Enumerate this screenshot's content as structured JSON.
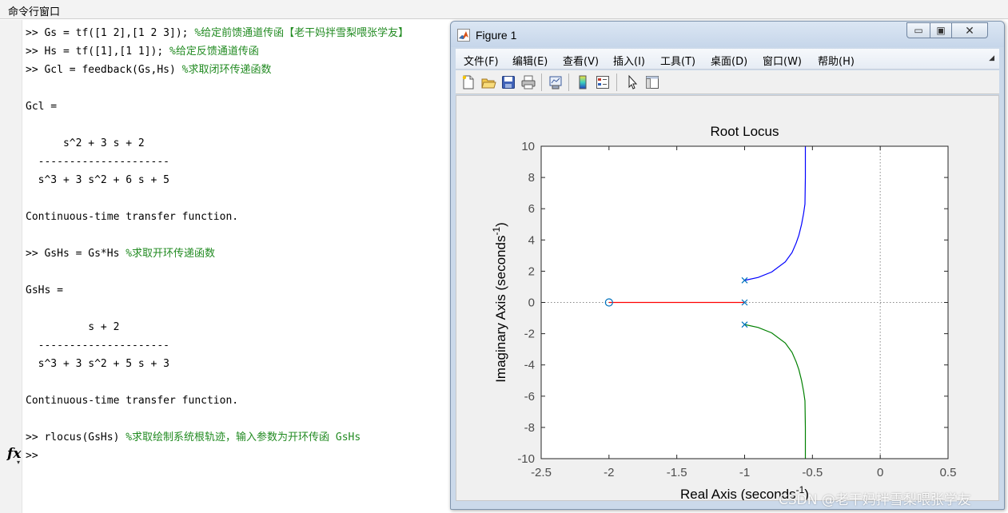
{
  "command_window": {
    "title": "命令行窗口",
    "lines": [
      {
        "code": ">> Gs = tf([1 2],[1 2 3]); ",
        "comment": "%给定前馈通道传函【老干妈拌雪梨喂张学友】"
      },
      {
        "code": ">> Hs = tf([1],[1 1]); ",
        "comment": "%给定反馈通道传函"
      },
      {
        "code": ">> Gcl = feedback(Gs,Hs) ",
        "comment": "%求取闭环传递函数"
      },
      {
        "code": "",
        "comment": ""
      },
      {
        "code": "Gcl =",
        "comment": ""
      },
      {
        "code": "",
        "comment": ""
      },
      {
        "code": "      s^2 + 3 s + 2",
        "comment": ""
      },
      {
        "code": "  ---------------------",
        "comment": ""
      },
      {
        "code": "  s^3 + 3 s^2 + 6 s + 5",
        "comment": ""
      },
      {
        "code": "",
        "comment": ""
      },
      {
        "code": "Continuous-time transfer function.",
        "comment": ""
      },
      {
        "code": "",
        "comment": ""
      },
      {
        "code": ">> GsHs = Gs*Hs ",
        "comment": "%求取开环传递函数"
      },
      {
        "code": "",
        "comment": ""
      },
      {
        "code": "GsHs =",
        "comment": ""
      },
      {
        "code": "",
        "comment": ""
      },
      {
        "code": "          s + 2",
        "comment": ""
      },
      {
        "code": "  ---------------------",
        "comment": ""
      },
      {
        "code": "  s^3 + 3 s^2 + 5 s + 3",
        "comment": ""
      },
      {
        "code": "",
        "comment": ""
      },
      {
        "code": "Continuous-time transfer function.",
        "comment": ""
      },
      {
        "code": "",
        "comment": ""
      },
      {
        "code": ">> rlocus(GsHs) ",
        "comment": "%求取绘制系统根轨迹，输入参数为开环传函 GsHs"
      },
      {
        "code": ">>",
        "comment": ""
      }
    ],
    "fx_icon": "fx-function-browser-icon",
    "comment_color": "#228b22"
  },
  "figure_window": {
    "title": "Figure 1",
    "logo_icon": "matlab-logo-icon",
    "window_buttons": {
      "minimize": "▭",
      "maximize": "▣",
      "close": "✕"
    },
    "menu": [
      "文件(F)",
      "编辑(E)",
      "查看(V)",
      "插入(I)",
      "工具(T)",
      "桌面(D)",
      "窗口(W)",
      "帮助(H)"
    ],
    "menu_corner_icon": "dock-arrow-icon",
    "toolbar_icons": [
      "new-figure-icon",
      "open-file-icon",
      "save-icon",
      "print-icon",
      "link-plot-icon",
      "insert-colorbar-icon",
      "insert-legend-icon",
      "pointer-edit-icon",
      "property-inspector-icon"
    ]
  },
  "chart_data": {
    "type": "line",
    "title": "Root Locus",
    "xlabel": "Real Axis (seconds",
    "xlabel_sup": "-1",
    "xlabel_close": ")",
    "ylabel": "Imaginary Axis (seconds",
    "ylabel_sup": "-1",
    "ylabel_close": ")",
    "xlim": [
      -2.5,
      0.5
    ],
    "ylim": [
      -10,
      10
    ],
    "xticks": [
      -2.5,
      -2,
      -1.5,
      -1,
      -0.5,
      0,
      0.5
    ],
    "xtick_labels": [
      "-2.5",
      "-2",
      "-1.5",
      "-1",
      "-0.5",
      "0",
      "0.5"
    ],
    "yticks": [
      -10,
      -8,
      -6,
      -4,
      -2,
      0,
      2,
      4,
      6,
      8,
      10
    ],
    "ytick_labels": [
      "-10",
      "-8",
      "-6",
      "-4",
      "-2",
      "0",
      "2",
      "4",
      "6",
      "8",
      "10"
    ],
    "poles": [
      [
        -1,
        1.414
      ],
      [
        -1,
        0
      ],
      [
        -1,
        -1.414
      ]
    ],
    "zeros": [
      [
        -2,
        0
      ]
    ],
    "series": [
      {
        "color": "#0000ff",
        "x": [
          -1.0,
          -0.9,
          -0.8,
          -0.7,
          -0.65,
          -0.62,
          -0.6,
          -0.58,
          -0.565,
          -0.555,
          -0.552,
          -0.552
        ],
        "y": [
          1.414,
          1.6,
          1.95,
          2.6,
          3.2,
          3.8,
          4.3,
          5.0,
          5.7,
          6.3,
          8.0,
          10.0
        ]
      },
      {
        "color": "#ff0000",
        "x": [
          -2.0,
          -1.0
        ],
        "y": [
          0,
          0
        ]
      },
      {
        "color": "#008000",
        "x": [
          -1.0,
          -0.9,
          -0.8,
          -0.7,
          -0.65,
          -0.62,
          -0.6,
          -0.58,
          -0.565,
          -0.555,
          -0.552,
          -0.552
        ],
        "y": [
          -1.414,
          -1.6,
          -1.95,
          -2.6,
          -3.2,
          -3.8,
          -4.3,
          -5.0,
          -5.7,
          -6.3,
          -8.0,
          -10.0
        ]
      }
    ],
    "pole_color": "#0072bd",
    "zero_color": "#0072bd",
    "grid": false
  },
  "watermark": "CSDN @老干妈拌雪梨喂张学友"
}
